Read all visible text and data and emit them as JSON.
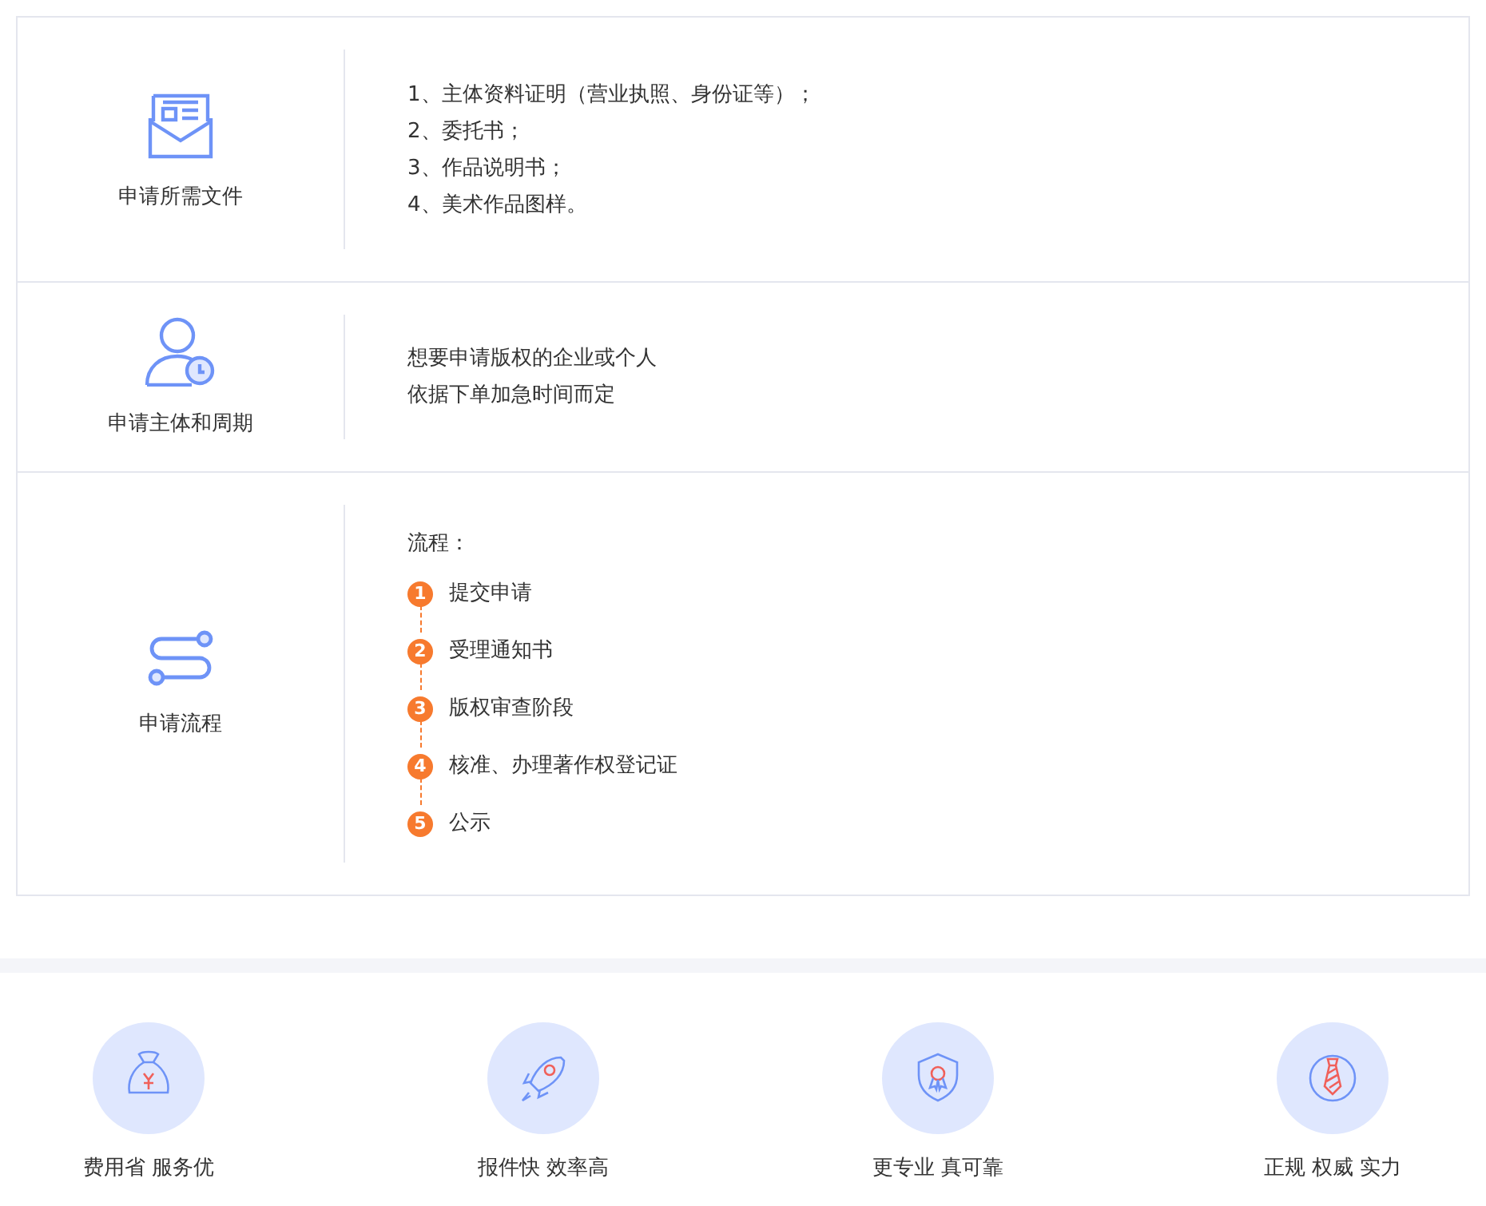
{
  "sections": [
    {
      "label": "申请所需文件",
      "kind": "lines",
      "lines": [
        "1、主体资料证明（营业执照、身份证等）；",
        "2、委托书；",
        "3、作品说明书；",
        "4、美术作品图样。"
      ]
    },
    {
      "label": "申请主体和周期",
      "kind": "lines",
      "lines": [
        "想要申请版权的企业或个人",
        "依据下单加急时间而定"
      ]
    },
    {
      "label": "申请流程",
      "kind": "steps",
      "heading": "流程：",
      "steps": [
        {
          "num": "1",
          "text": "提交申请"
        },
        {
          "num": "2",
          "text": "受理通知书"
        },
        {
          "num": "3",
          "text": "版权审查阶段"
        },
        {
          "num": "4",
          "text": "核准、办理著作权登记证"
        },
        {
          "num": "5",
          "text": "公示"
        }
      ]
    }
  ],
  "features": [
    {
      "label": "费用省 服务优"
    },
    {
      "label": "报件快 效率高"
    },
    {
      "label": "更专业 真可靠"
    },
    {
      "label": "正规 权威 实力"
    }
  ]
}
